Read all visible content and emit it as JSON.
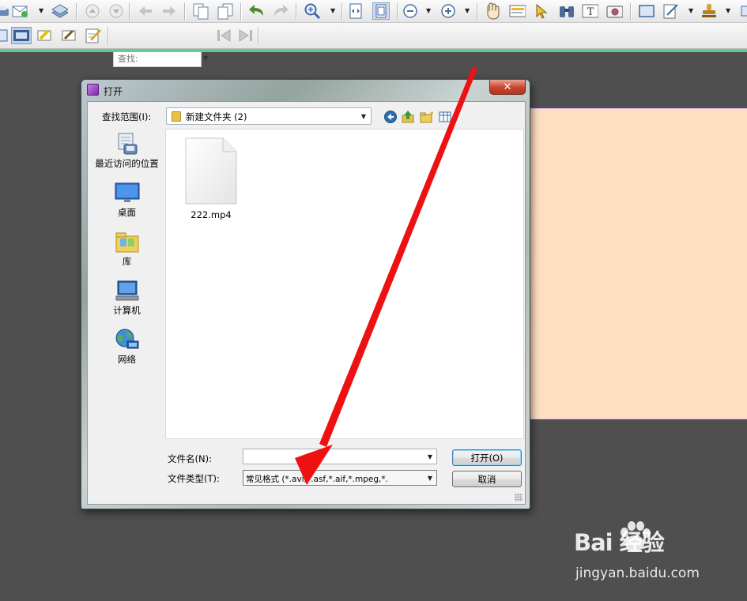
{
  "toolbar": {
    "find_placeholder": "查找:"
  },
  "dialog": {
    "title": "打开",
    "close_glyph": "✕",
    "look_in_label": "查找范围(I):",
    "look_in_value": "新建文件夹 (2)",
    "places": [
      {
        "label": "最近访问的位置",
        "icon": "recent-places-icon"
      },
      {
        "label": "桌面",
        "icon": "desktop-icon"
      },
      {
        "label": "库",
        "icon": "libraries-icon"
      },
      {
        "label": "计算机",
        "icon": "computer-icon"
      },
      {
        "label": "网络",
        "icon": "network-icon"
      }
    ],
    "files": [
      {
        "name": "222.mp4",
        "icon": "blank-file-icon"
      }
    ],
    "filename_label": "文件名(N):",
    "filename_value": "",
    "filetype_label": "文件类型(T):",
    "filetype_value": "常见格式 (*.avi,*.asf,*.aif,*.mpeg,*.",
    "open_button": "打开(O)",
    "cancel_button": "取消"
  },
  "watermark": {
    "brand": "Bai 经验",
    "url": "jingyan.baidu.com"
  },
  "colors": {
    "workspace": "#4f4f4f",
    "page": "#ffdfc0",
    "annotation_arrow": "#ee1111",
    "toolbar_accent": "#5fd08a"
  }
}
